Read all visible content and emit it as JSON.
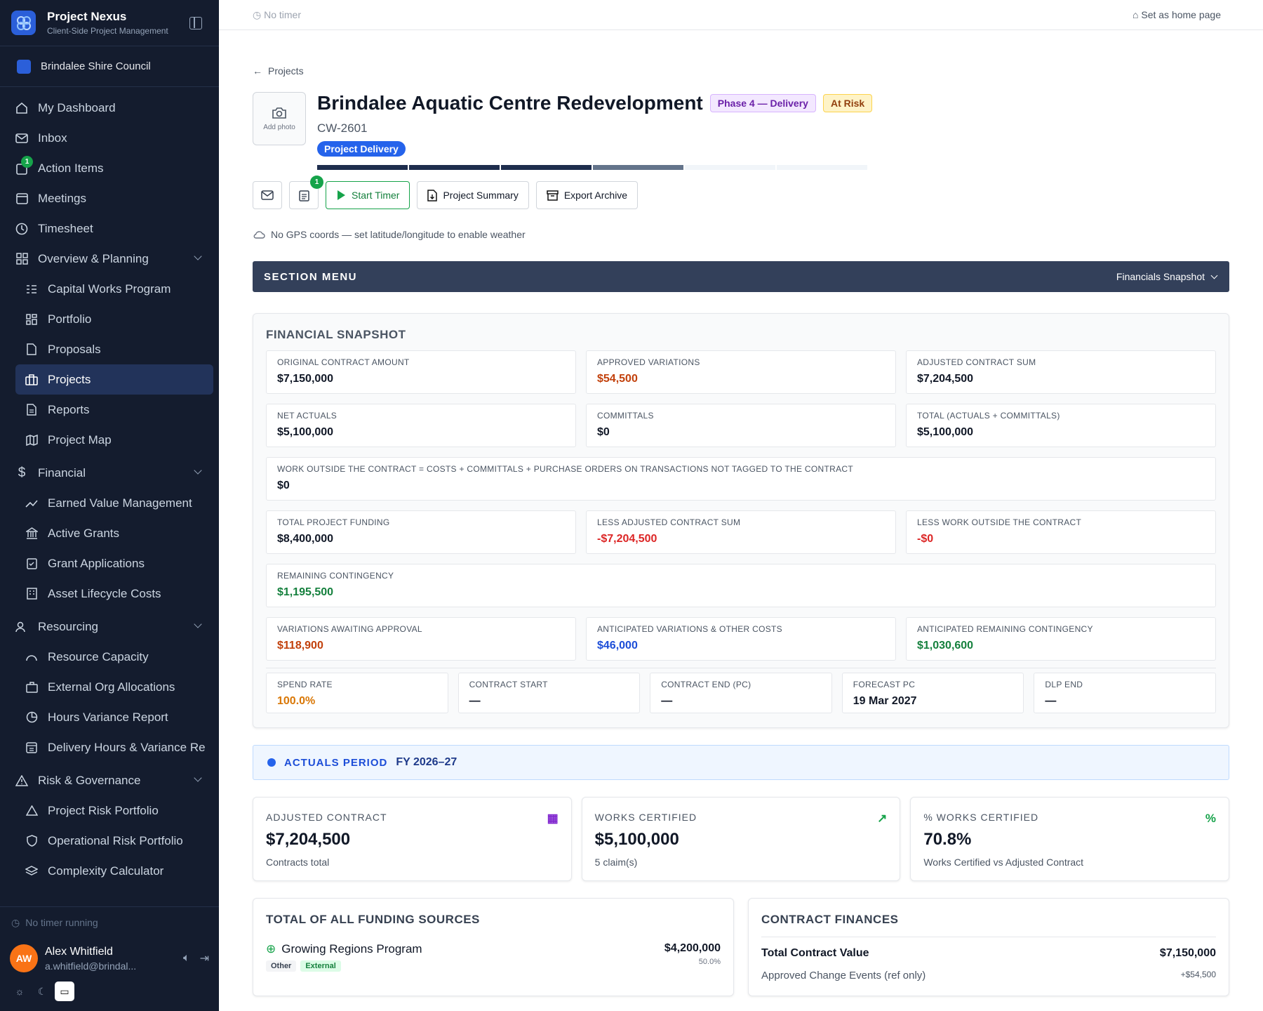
{
  "app": {
    "title": "Project Nexus",
    "subtitle": "Client-Side Project Management",
    "org": "Brindalee Shire Council"
  },
  "nav": {
    "dashboard": "My Dashboard",
    "inbox": "Inbox",
    "action_items": "Action Items",
    "action_badge": "1",
    "meetings": "Meetings",
    "timesheet": "Timesheet",
    "overview": "Overview & Planning",
    "capital": "Capital Works Program",
    "portfolio": "Portfolio",
    "proposals": "Proposals",
    "projects": "Projects",
    "reports": "Reports",
    "project_map": "Project Map",
    "financial": "Financial",
    "evm": "Earned Value Management",
    "active_grants": "Active Grants",
    "grant_apps": "Grant Applications",
    "asset": "Asset Lifecycle Costs",
    "resourcing": "Resourcing",
    "capacity": "Resource Capacity",
    "ext_org": "External Org Allocations",
    "hours_var": "Hours Variance Report",
    "delivery_hours": "Delivery Hours & Variance Re",
    "risk": "Risk & Governance",
    "proj_risk": "Project Risk Portfolio",
    "op_risk": "Operational Risk Portfolio",
    "complexity": "Complexity Calculator"
  },
  "footer": {
    "timer": "No timer running",
    "user_name": "Alex Whitfield",
    "user_email": "a.whitfield@brindal...",
    "initials": "AW"
  },
  "topbar": {
    "timer": "No timer",
    "home": "Set as home page"
  },
  "project": {
    "back": "Projects",
    "add_photo": "Add photo",
    "title": "Brindalee Aquatic Centre Redevelopment",
    "phase": "Phase 4 — Delivery",
    "status": "At Risk",
    "code": "CW-2601",
    "stage": "Project Delivery"
  },
  "progress": {
    "segments": [
      "done",
      "done",
      "done",
      "current",
      "todo",
      "todo"
    ]
  },
  "actions": {
    "badge": "1",
    "start_timer": "Start Timer",
    "summary": "Project Summary",
    "archive": "Export Archive"
  },
  "gps": "No GPS coords — set latitude/longitude to enable weather",
  "section_menu": {
    "label": "SECTION MENU",
    "selected": "Financials Snapshot"
  },
  "financial_snapshot": {
    "title": "FINANCIAL SNAPSHOT",
    "rows": [
      [
        {
          "k": "ORIGINAL CONTRACT AMOUNT",
          "v": "$7,150,000",
          "c": "#111827"
        },
        {
          "k": "APPROVED VARIATIONS",
          "v": "$54,500",
          "c": "#c2410c"
        },
        {
          "k": "ADJUSTED CONTRACT SUM",
          "v": "$7,204,500",
          "c": "#111827"
        }
      ],
      [
        {
          "k": "NET ACTUALS",
          "v": "$5,100,000",
          "c": "#111827"
        },
        {
          "k": "COMMITTALS",
          "v": "$0",
          "c": "#111827"
        },
        {
          "k": "TOTAL (ACTUALS + COMMITTALS)",
          "v": "$5,100,000",
          "c": "#111827"
        }
      ],
      [
        {
          "k": "WORK OUTSIDE THE CONTRACT = COSTS + COMMITTALS + PURCHASE ORDERS ON TRANSACTIONS NOT TAGGED TO THE CONTRACT",
          "v": "$0",
          "c": "#111827"
        }
      ],
      [
        {
          "k": "TOTAL PROJECT FUNDING",
          "v": "$8,400,000",
          "c": "#111827"
        },
        {
          "k": "LESS ADJUSTED CONTRACT SUM",
          "v": "-$7,204,500",
          "c": "#dc2626"
        },
        {
          "k": "LESS WORK OUTSIDE THE CONTRACT",
          "v": "-$0",
          "c": "#dc2626"
        }
      ],
      [
        {
          "k": "REMAINING CONTINGENCY",
          "v": "$1,195,500",
          "c": "#15803d"
        }
      ],
      [
        {
          "k": "VARIATIONS AWAITING APPROVAL",
          "v": "$118,900",
          "c": "#c2410c"
        },
        {
          "k": "ANTICIPATED VARIATIONS & OTHER COSTS",
          "v": "$46,000",
          "c": "#1d4ed8"
        },
        {
          "k": "ANTICIPATED REMAINING CONTINGENCY",
          "v": "$1,030,600",
          "c": "#15803d"
        }
      ]
    ],
    "dates": [
      {
        "k": "SPEND RATE",
        "v": "100.0%",
        "c": "#d97706"
      },
      {
        "k": "CONTRACT START",
        "v": "—",
        "c": "#111827"
      },
      {
        "k": "CONTRACT END (PC)",
        "v": "—",
        "c": "#111827"
      },
      {
        "k": "FORECAST PC",
        "v": "19 Mar 2027",
        "c": "#111827"
      },
      {
        "k": "DLP END",
        "v": "—",
        "c": "#111827"
      }
    ]
  },
  "actuals_period": {
    "label": "ACTUALS PERIOD",
    "value": "FY 2026–27"
  },
  "kpis": [
    {
      "k": "ADJUSTED CONTRACT",
      "v": "$7,204,500",
      "s": "Contracts total",
      "icon": "building-icon",
      "color": "#7e22ce"
    },
    {
      "k": "WORKS CERTIFIED",
      "v": "$5,100,000",
      "s": "5 claim(s)",
      "icon": "trending-up-icon",
      "color": "#16a34a"
    },
    {
      "k": "% WORKS CERTIFIED",
      "v": "70.8%",
      "s": "Works Certified vs Adjusted Contract",
      "icon": "percent-icon",
      "color": "#16a34a"
    }
  ],
  "funding": {
    "title": "TOTAL OF ALL FUNDING SOURCES",
    "source": "Growing Regions Program",
    "amount": "$4,200,000",
    "pct": "50.0%",
    "tag1": "Other",
    "tag2": "External"
  },
  "contract_finances": {
    "title": "CONTRACT FINANCES",
    "label": "Total Contract Value",
    "value": "$7,150,000",
    "next_label": "Approved Change Events (ref only)",
    "next_value": "+$54,500"
  }
}
